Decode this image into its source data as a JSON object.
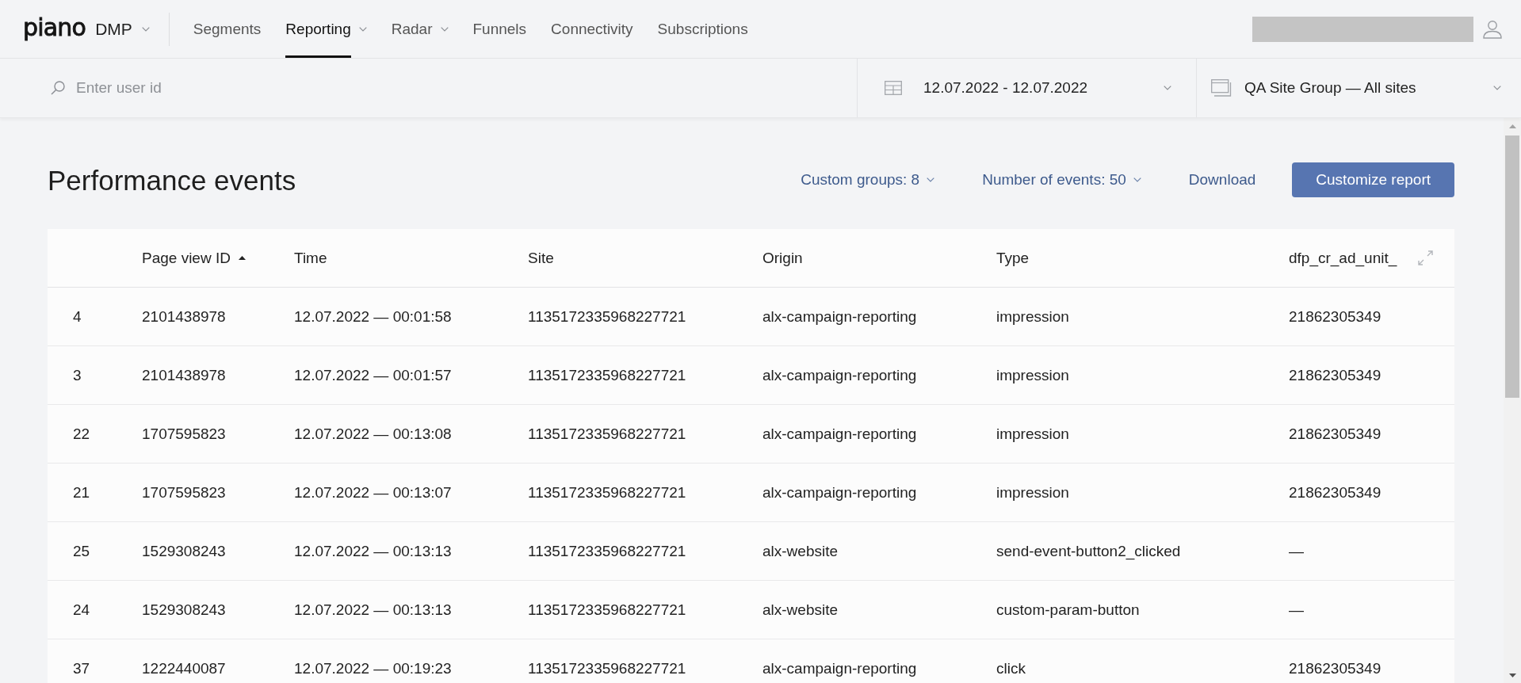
{
  "header": {
    "logo": "piano",
    "product": {
      "label": "DMP",
      "dropdown": true
    },
    "nav": [
      {
        "label": "Segments",
        "selected": false,
        "dropdown": false
      },
      {
        "label": "Reporting",
        "selected": true,
        "dropdown": true
      },
      {
        "label": "Radar",
        "selected": false,
        "dropdown": true
      },
      {
        "label": "Funnels",
        "selected": false,
        "dropdown": false
      },
      {
        "label": "Connectivity",
        "selected": false,
        "dropdown": false
      },
      {
        "label": "Subscriptions",
        "selected": false,
        "dropdown": false
      }
    ]
  },
  "filters": {
    "search": {
      "placeholder": "Enter user id"
    },
    "date_range": {
      "value": "12.07.2022 - 12.07.2022"
    },
    "site_group": {
      "value": "QA Site Group — All sites"
    }
  },
  "report": {
    "title": "Performance events",
    "actions": [
      {
        "kind": "dropdown",
        "label": "Custom groups: 8"
      },
      {
        "kind": "dropdown",
        "label": "Number of events: 50"
      },
      {
        "kind": "link",
        "label": "Download"
      },
      {
        "kind": "button",
        "label": "Customize report"
      }
    ]
  },
  "table": {
    "columns": [
      null,
      {
        "label": "Page view ID",
        "sorted": true
      },
      {
        "label": "Time",
        "sorted": false
      },
      {
        "label": "Site",
        "sorted": false
      },
      {
        "label": "Origin",
        "sorted": false
      },
      {
        "label": "Type",
        "sorted": false
      },
      {
        "label": "dfp_cr_ad_unit_",
        "sorted": false
      }
    ],
    "rows": [
      [
        "4",
        "2101438978",
        "12.07.2022 — 00:01:58",
        "1135172335968227721",
        "alx-campaign-reporting",
        "impression",
        "21862305349"
      ],
      [
        "3",
        "2101438978",
        "12.07.2022 — 00:01:57",
        "1135172335968227721",
        "alx-campaign-reporting",
        "impression",
        "21862305349"
      ],
      [
        "22",
        "1707595823",
        "12.07.2022 — 00:13:08",
        "1135172335968227721",
        "alx-campaign-reporting",
        "impression",
        "21862305349"
      ],
      [
        "21",
        "1707595823",
        "12.07.2022 — 00:13:07",
        "1135172335968227721",
        "alx-campaign-reporting",
        "impression",
        "21862305349"
      ],
      [
        "25",
        "1529308243",
        "12.07.2022 — 00:13:13",
        "1135172335968227721",
        "alx-website",
        "send-event-button2_clicked",
        "—"
      ],
      [
        "24",
        "1529308243",
        "12.07.2022 — 00:13:13",
        "1135172335968227721",
        "alx-website",
        "custom-param-button",
        "—"
      ],
      [
        "37",
        "1222440087",
        "12.07.2022 — 00:19:23",
        "1135172335968227721",
        "alx-campaign-reporting",
        "click",
        "21862305349"
      ]
    ]
  }
}
